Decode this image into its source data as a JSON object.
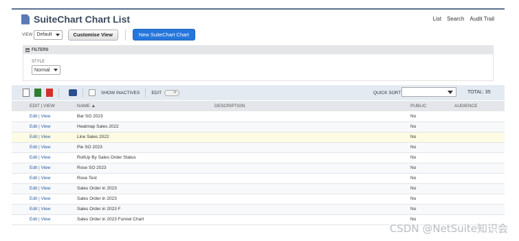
{
  "page": {
    "title": "SuiteChart Chart List",
    "icon": "document-icon"
  },
  "top_links": [
    "List",
    "Search",
    "Audit Trail"
  ],
  "view": {
    "label": "VIEW",
    "selected": "Default",
    "customise_label": "Customise View",
    "new_label": "New SuiteChart Chart"
  },
  "filters": {
    "header": "FILTERS",
    "style_label": "STYLE",
    "style_value": "Normal"
  },
  "toolbar": {
    "show_inactives": "SHOW INACTIVES",
    "edit": "EDIT",
    "quick_sort": "QUICK SORT",
    "total": "TOTAL: 35"
  },
  "table": {
    "headers": {
      "edit_view": "EDIT | VIEW",
      "name": "NAME ▲",
      "description": "DESCRIPTION",
      "public": "PUBLIC",
      "audience": "AUDIENCE"
    },
    "edit_label": "Edit",
    "view_label": "View",
    "rows": [
      {
        "name": "Bar SO 2023",
        "description": "",
        "public": "No",
        "audience": ""
      },
      {
        "name": "Heatmap Sales 2022",
        "description": "",
        "public": "No",
        "audience": ""
      },
      {
        "name": "Line Sales 2022",
        "description": "",
        "public": "No",
        "audience": ""
      },
      {
        "name": "Pie SO 2023",
        "description": "",
        "public": "No",
        "audience": ""
      },
      {
        "name": "RollUp By Sales Order Status",
        "description": "",
        "public": "No",
        "audience": ""
      },
      {
        "name": "Rose SO 2023",
        "description": "",
        "public": "No",
        "audience": ""
      },
      {
        "name": "Rose Test",
        "description": "",
        "public": "No",
        "audience": ""
      },
      {
        "name": "Sales Order in 2023",
        "description": "",
        "public": "No",
        "audience": ""
      },
      {
        "name": "Sales Order in 2023",
        "description": "",
        "public": "No",
        "audience": ""
      },
      {
        "name": "Sales Order in 2023 F",
        "description": "",
        "public": "No",
        "audience": ""
      },
      {
        "name": "Sales Order in 2023 Funnel Chart",
        "description": "",
        "public": "No",
        "audience": ""
      }
    ]
  },
  "watermark": "CSDN @NetSuite知识会",
  "colors": {
    "primary_button": "#2677dc",
    "title": "#3b4a5f",
    "link": "#255ba8",
    "highlight_row": "#fdfbe3"
  }
}
